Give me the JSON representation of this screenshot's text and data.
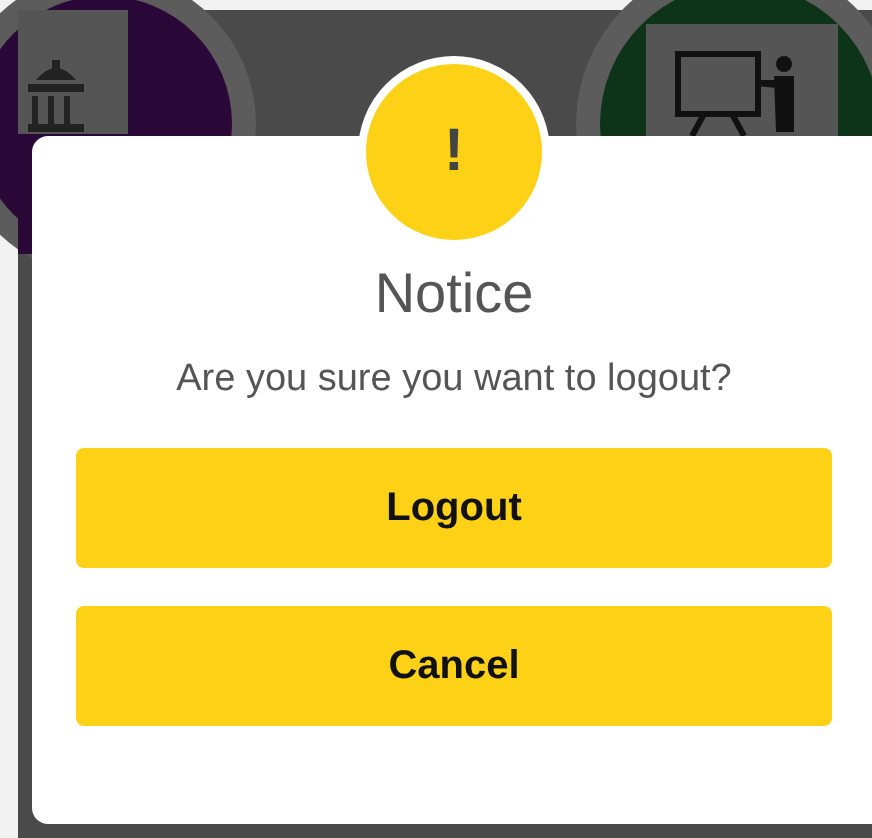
{
  "dialog": {
    "icon_text": "!",
    "title": "Notice",
    "message": "Are you sure you want to logout?",
    "buttons": [
      {
        "label": "Logout"
      },
      {
        "label": "Cancel"
      }
    ]
  }
}
